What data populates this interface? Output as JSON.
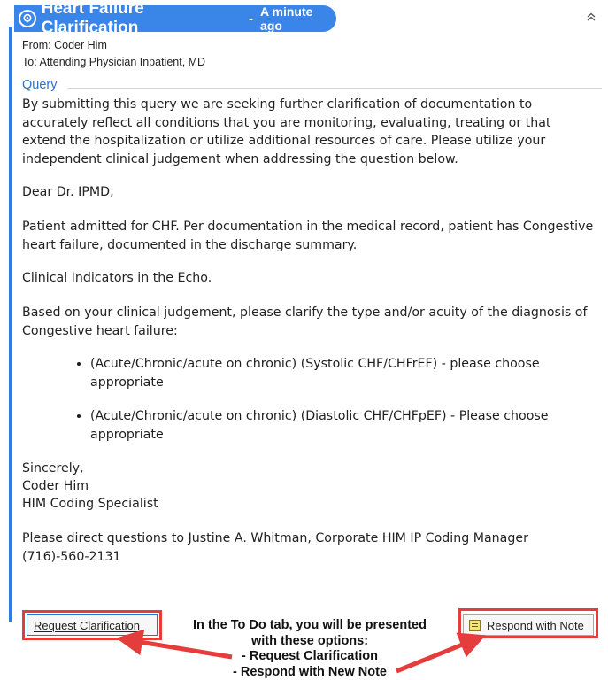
{
  "header": {
    "title": "Heart Failure Clarification",
    "separator": "-",
    "time": "A minute ago"
  },
  "meta": {
    "from_label": "From:",
    "from_value": "Coder Him",
    "to_label": "To:",
    "to_value": "Attending Physician Inpatient, MD"
  },
  "section": {
    "label": "Query"
  },
  "message": {
    "intro": "By submitting this query we are seeking further clarification of documentation to accurately reflect all conditions that you are monitoring, evaluating, treating or that extend the hospitalization or utilize additional resources of care. Please utilize your independent clinical judgement when addressing the question below.",
    "greeting": "Dear Dr. IPMD,",
    "p1": "Patient admitted for CHF.  Per documentation in the medical record, patient has Congestive heart failure, documented in the discharge summary.",
    "p2": "Clinical Indicators in the Echo.",
    "p3": "Based on your clinical judgement, please clarify the type and/or acuity of the diagnosis of Congestive heart failure:",
    "bullets": [
      "(Acute/Chronic/acute on chronic) (Systolic CHF/CHFrEF) - please choose appropriate",
      "(Acute/Chronic/acute on chronic) (Diastolic CHF/CHFpEF) - Please choose appropriate"
    ],
    "signoff": "Sincerely,",
    "sig_name": "Coder Him",
    "sig_title": "HIM Coding Specialist",
    "contact": "Please direct questions to Justine A. Whitman, Corporate HIM IP Coding Manager (716)-560-2131"
  },
  "buttons": {
    "request_label": "Request Clarification",
    "respond_label": "Respond with Note"
  },
  "callout": {
    "line1": "In the To Do tab, you will be presented",
    "line2": "with these options:",
    "line3": "- Request Clarification",
    "line4": "- Respond with New Note"
  },
  "colors": {
    "header_bg": "#3a86e8",
    "accent_blue": "#2f6fd0",
    "highlight_red": "#e53c3c"
  },
  "icons": {
    "header": "message-bubble-icon",
    "collapse": "double-chevron-up-icon",
    "note": "note-icon"
  }
}
